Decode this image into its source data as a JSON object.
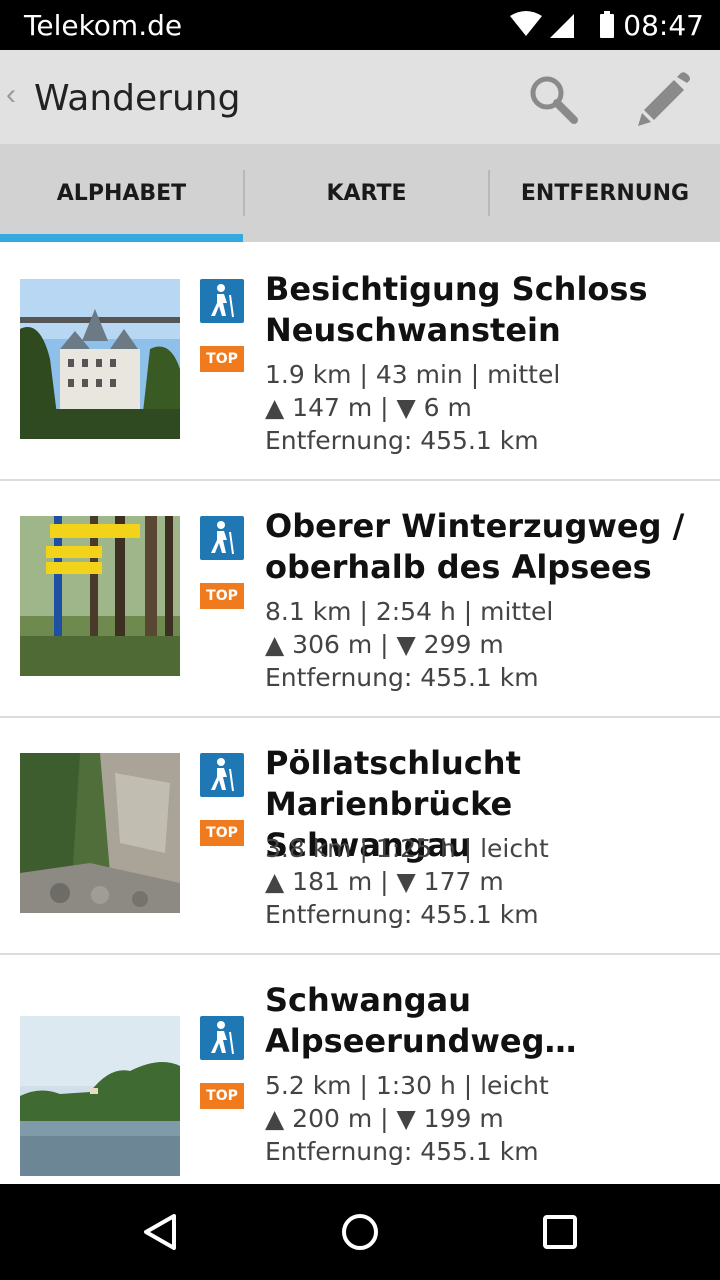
{
  "status": {
    "carrier": "Telekom.de",
    "time": "08:47"
  },
  "appbar": {
    "back_glyph": "‹",
    "title": "Wanderung",
    "search_icon": "search-icon",
    "edit_icon": "pencil-icon"
  },
  "tabs": [
    {
      "label": "ALPHABET",
      "selected": true
    },
    {
      "label": "KARTE",
      "selected": false
    },
    {
      "label": "ENTFERNUNG",
      "selected": false
    }
  ],
  "colors": {
    "accent": "#33a9e0",
    "hike_icon_bg": "#1f78b4",
    "top_badge": "#f07a1e"
  },
  "items": [
    {
      "title_line1": "Besichtigung Schloss",
      "title_line2": "Neuschwanstein",
      "stats": "1.9 km | 43 min | mittel",
      "elevation": "▲ 147 m | ▼ 6 m",
      "distance": "Entfernung: 455.1 km",
      "badge": "TOP"
    },
    {
      "title_line1": "Oberer Winterzugweg /",
      "title_line2": "oberhalb des Alpsees",
      "stats": "8.1 km | 2:54 h | mittel",
      "elevation": "▲ 306 m | ▼ 299 m",
      "distance": "Entfernung: 455.1 km",
      "badge": "TOP"
    },
    {
      "title_line1": "Pöllatschlucht",
      "title_line2": "Marienbrücke Schwangau",
      "stats": "3.8 km | 1:25 h | leicht",
      "elevation": "▲ 181 m | ▼ 177 m",
      "distance": "Entfernung: 455.1 km",
      "badge": "TOP"
    },
    {
      "title_line1": "Schwangau",
      "title_line2": "Alpseerundweg…",
      "stats": "5.2 km | 1:30 h | leicht",
      "elevation": "▲ 200 m | ▼ 199 m",
      "distance": "Entfernung: 455.1 km",
      "badge": "TOP"
    }
  ]
}
